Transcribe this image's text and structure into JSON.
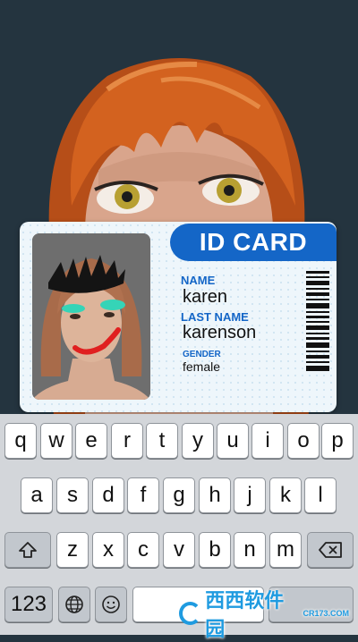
{
  "card": {
    "title": "ID CARD",
    "name_label": "NAME",
    "name_value": "karen",
    "last_name_label": "LAST NAME",
    "last_name_value": "karenson",
    "gender_label": "GENDER",
    "gender_value": "female"
  },
  "keyboard": {
    "row1": [
      "q",
      "w",
      "e",
      "r",
      "t",
      "y",
      "u",
      "i",
      "o",
      "p"
    ],
    "row2": [
      "a",
      "s",
      "d",
      "f",
      "g",
      "h",
      "j",
      "k",
      "l"
    ],
    "row3": [
      "z",
      "x",
      "c",
      "v",
      "b",
      "n",
      "m"
    ],
    "numbers_label": "123",
    "icons": {
      "shift": "shift-icon",
      "backspace": "backspace-icon",
      "globe": "globe-icon",
      "emoji": "emoji-icon"
    }
  },
  "watermark": {
    "brand": "西西软件园",
    "site": "CR173.COM"
  },
  "colors": {
    "card_blue": "#1466c7",
    "hair": "#c8581e",
    "background": "#24343f"
  }
}
